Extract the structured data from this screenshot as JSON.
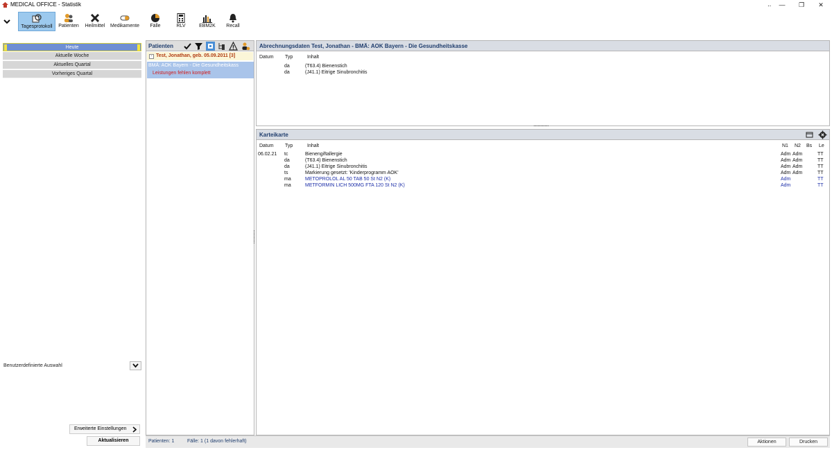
{
  "window": {
    "title": "MEDICAL OFFICE - Statistik",
    "drag_handle": "‥",
    "minimize": "—",
    "restore": "❐",
    "close": "✕"
  },
  "toolbar": {
    "items": [
      {
        "label": "Tagesprotokoll",
        "icon": "tagesprotokoll-icon",
        "active": true
      },
      {
        "label": "Patienten",
        "icon": "patients-icon"
      },
      {
        "label": "Heilmittel",
        "icon": "heilmittel-icon"
      },
      {
        "label": "Medikamente",
        "icon": "pill-icon"
      },
      {
        "label": "Fälle",
        "icon": "pie-chart-icon"
      },
      {
        "label": "RLV",
        "icon": "calculator-icon"
      },
      {
        "label": "EBM2K",
        "icon": "bar-chart-icon"
      },
      {
        "label": "Recall",
        "icon": "bell-icon"
      }
    ]
  },
  "left_panel": {
    "periods": [
      "Heute",
      "Aktuelle Woche",
      "Aktuelles Quartal",
      "Vorheriges Quartal"
    ],
    "custom_selection_label": "Benutzerdefinierte Auswahl",
    "extended_settings_label": "Erweiterte Einstellungen",
    "refresh_label": "Aktualisieren"
  },
  "patients_panel": {
    "title": "Patienten",
    "toggle": "-",
    "patient_row": "Test, Jonathan, geb. 05.09.2011 [3]",
    "selected_line1": "BMÄ: AOK Bayern - Die Gesundheitskass",
    "selected_line2": "Leistungen fehlen komplett"
  },
  "billing_panel": {
    "title": "Abrechnungsdaten Test, Jonathan - BMÄ: AOK Bayern - Die Gesundheitskasse",
    "columns": {
      "datum": "Datum",
      "typ": "Typ",
      "inhalt": "Inhalt"
    },
    "rows": [
      {
        "typ": "da",
        "inhalt": "(T63.4) Bienenstich"
      },
      {
        "typ": "da",
        "inhalt": "(J41.1) Eitrige Sinubronchitis"
      }
    ]
  },
  "karteikarte": {
    "title": "Karteikarte",
    "columns": {
      "datum": "Datum",
      "typ": "Typ",
      "inhalt": "Inhalt",
      "n1": "N1",
      "n2": "N2",
      "bs": "Bs",
      "le": "Le"
    },
    "rows": [
      {
        "datum": "06.02.21",
        "typ": "tc",
        "inhalt": "Bienengiftallergie",
        "n1": "Adm",
        "n2": "Adm",
        "le": "TT",
        "blue": false
      },
      {
        "datum": "",
        "typ": "da",
        "inhalt": "(T63.4) Bienenstich",
        "n1": "Adm",
        "n2": "Adm",
        "le": "TT",
        "blue": false
      },
      {
        "datum": "",
        "typ": "da",
        "inhalt": "(J41.1) Eitrige Sinubronchitis",
        "n1": "Adm",
        "n2": "Adm",
        "le": "TT",
        "blue": false
      },
      {
        "datum": "",
        "typ": "ts",
        "inhalt": "Markierung gesetzt: 'Kinderprogramm AOK'",
        "n1": "Adm",
        "n2": "Adm",
        "le": "TT",
        "blue": false
      },
      {
        "datum": "",
        "typ": "ma",
        "inhalt": "METOPROLOL AL 50 TAB 50 St N2 (K)",
        "n1": "Adm",
        "n2": "",
        "le": "TT",
        "blue": true
      },
      {
        "datum": "",
        "typ": "ma",
        "inhalt": "METFORMIN LICH 500MG FTA 120 St N2 (K)",
        "n1": "Adm",
        "n2": "",
        "le": "TT",
        "blue": true
      }
    ]
  },
  "statusbar": {
    "patients": "Patienten: 1",
    "cases": "Fälle: 1 (1 davon fehlerhaft)",
    "actions_label": "Aktionen",
    "print_label": "Drucken"
  },
  "colors": {
    "accent": "#6f8fd3",
    "selection": "#a9c4ea",
    "error": "#d11a1a",
    "medication": "#1c2ea8",
    "header_text": "#1f3d6d"
  }
}
